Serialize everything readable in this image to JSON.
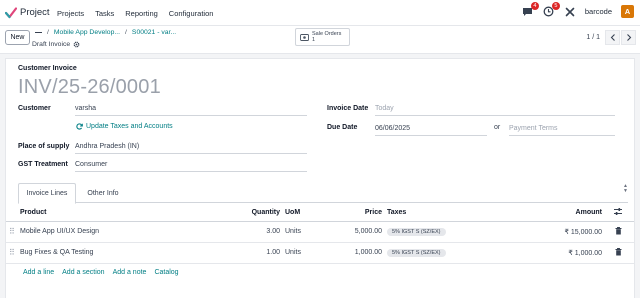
{
  "navbar": {
    "app_name": "Project",
    "menu": [
      "Projects",
      "Tasks",
      "Reporting",
      "Configuration"
    ],
    "chat_badge": "4",
    "activity_badge": "5",
    "company": "barcode",
    "avatar_letter": "A"
  },
  "control": {
    "new_label": "New",
    "breadcrumb": [
      "Mobile App Develop...",
      "S00021 - var..."
    ],
    "current_record": "Draft Invoice",
    "smart_button": {
      "line1": "Sale Orders",
      "line2": "1"
    },
    "pager": "1 / 1"
  },
  "form": {
    "doc_type": "Customer Invoice",
    "name": "INV/25-26/0001",
    "customer_label": "Customer",
    "customer_value": "varsha",
    "update_taxes_label": "Update Taxes and Accounts",
    "place_of_supply_label": "Place of supply",
    "place_of_supply_value": "Andhra Pradesh (IN)",
    "gst_treatment_label": "GST Treatment",
    "gst_treatment_value": "Consumer",
    "invoice_date_label": "Invoice Date",
    "invoice_date_placeholder": "Today",
    "due_date_label": "Due Date",
    "due_date_value": "06/06/2025",
    "or_label": "or",
    "payment_terms_placeholder": "Payment Terms"
  },
  "tabs": [
    "Invoice Lines",
    "Other Info"
  ],
  "lines": {
    "headers": {
      "product": "Product",
      "quantity": "Quantity",
      "uom": "UoM",
      "price": "Price",
      "taxes": "Taxes",
      "amount": "Amount"
    },
    "rows": [
      {
        "product": "Mobile App UI/UX Design",
        "quantity": "3.00",
        "uom": "Units",
        "price": "5,000.00",
        "tax": "5% IGST S (SZ/EX)",
        "amount": "₹ 15,000.00"
      },
      {
        "product": "Bug Fixes & QA Testing",
        "quantity": "1.00",
        "uom": "Units",
        "price": "1,000.00",
        "tax": "5% IGST S (SZ/EX)",
        "amount": "₹ 1,000.00"
      }
    ],
    "add_links": [
      "Add a line",
      "Add a section",
      "Add a note",
      "Catalog"
    ]
  },
  "colors": {
    "accent": "#017e84",
    "badge": "#dc2626",
    "avatar": "#d97706"
  }
}
